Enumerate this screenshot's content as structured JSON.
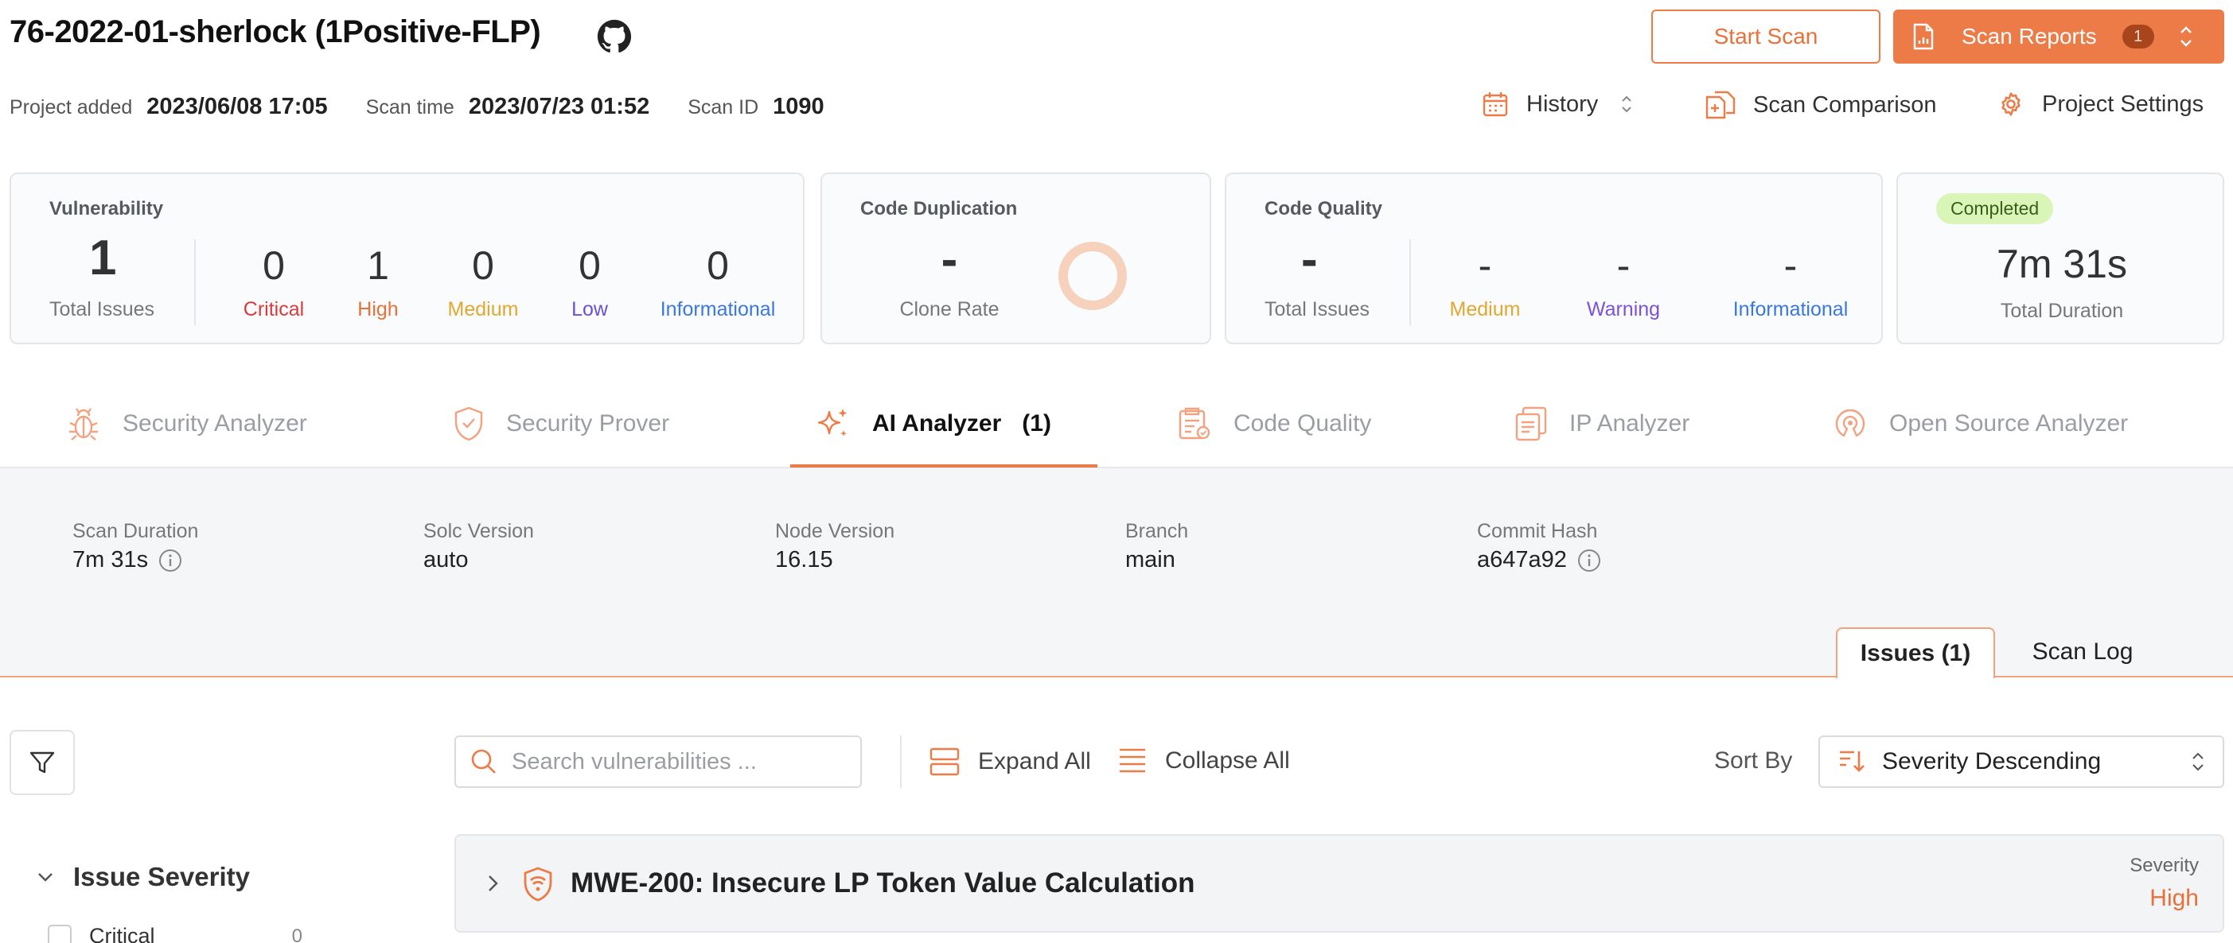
{
  "header": {
    "project_title": "76-2022-01-sherlock (1Positive-FLP)",
    "start_scan_label": "Start Scan",
    "scan_reports_label": "Scan Reports",
    "scan_reports_badge": "1",
    "project_added_label": "Project added",
    "project_added_value": "2023/06/08 17:05",
    "scan_time_label": "Scan time",
    "scan_time_value": "2023/07/23 01:52",
    "scan_id_label": "Scan ID",
    "scan_id_value": "1090",
    "history_label": "History",
    "scan_comparison_label": "Scan Comparison",
    "project_settings_label": "Project Settings"
  },
  "summary": {
    "vulnerability": {
      "title": "Vulnerability",
      "total": "1",
      "total_label": "Total Issues",
      "critical": "0",
      "critical_label": "Critical",
      "high": "1",
      "high_label": "High",
      "medium": "0",
      "medium_label": "Medium",
      "low": "0",
      "low_label": "Low",
      "informational": "0",
      "informational_label": "Informational"
    },
    "code_duplication": {
      "title": "Code Duplication",
      "value": "-",
      "label": "Clone Rate"
    },
    "code_quality": {
      "title": "Code Quality",
      "total": "-",
      "total_label": "Total Issues",
      "medium": "-",
      "medium_label": "Medium",
      "warning": "-",
      "warning_label": "Warning",
      "informational": "-",
      "informational_label": "Informational"
    },
    "status": {
      "badge": "Completed",
      "duration": "7m 31s",
      "duration_label": "Total Duration"
    }
  },
  "tabs": [
    {
      "label": "Security Analyzer",
      "icon": "bug-icon"
    },
    {
      "label": "Security Prover",
      "icon": "shield-check-icon"
    },
    {
      "label": "AI Analyzer",
      "count": "(1)",
      "icon": "sparkle-icon"
    },
    {
      "label": "Code Quality",
      "icon": "clipboard-icon"
    },
    {
      "label": "IP Analyzer",
      "icon": "documents-icon"
    },
    {
      "label": "Open Source Analyzer",
      "icon": "open-source-icon"
    }
  ],
  "scan_info": {
    "scan_duration_label": "Scan Duration",
    "scan_duration_value": "7m 31s",
    "solc_version_label": "Solc Version",
    "solc_version_value": "auto",
    "node_version_label": "Node Version",
    "node_version_value": "16.15",
    "branch_label": "Branch",
    "branch_value": "main",
    "commit_hash_label": "Commit Hash",
    "commit_hash_value": "a647a92"
  },
  "subtabs": {
    "issues_label": "Issues (1)",
    "scan_log_label": "Scan Log"
  },
  "toolbar": {
    "search_placeholder": "Search vulnerabilities ...",
    "expand_all_label": "Expand All",
    "collapse_all_label": "Collapse All",
    "sort_by_label": "Sort By",
    "sort_value": "Severity Descending"
  },
  "filters": {
    "issue_severity_title": "Issue Severity",
    "items": [
      {
        "label": "Critical",
        "count": "0"
      }
    ]
  },
  "issues": [
    {
      "title": "MWE-200: Insecure LP Token Value Calculation",
      "severity_label": "Severity",
      "severity": "High"
    }
  ],
  "colors": {
    "accent": "#ec7b47",
    "critical": "#d93b3b",
    "high": "#e8713a",
    "medium": "#e0a82e",
    "low": "#6b4fd8",
    "informational": "#3a78e0",
    "warning": "#7b52d6",
    "completed_bg": "#d9f5b8"
  }
}
